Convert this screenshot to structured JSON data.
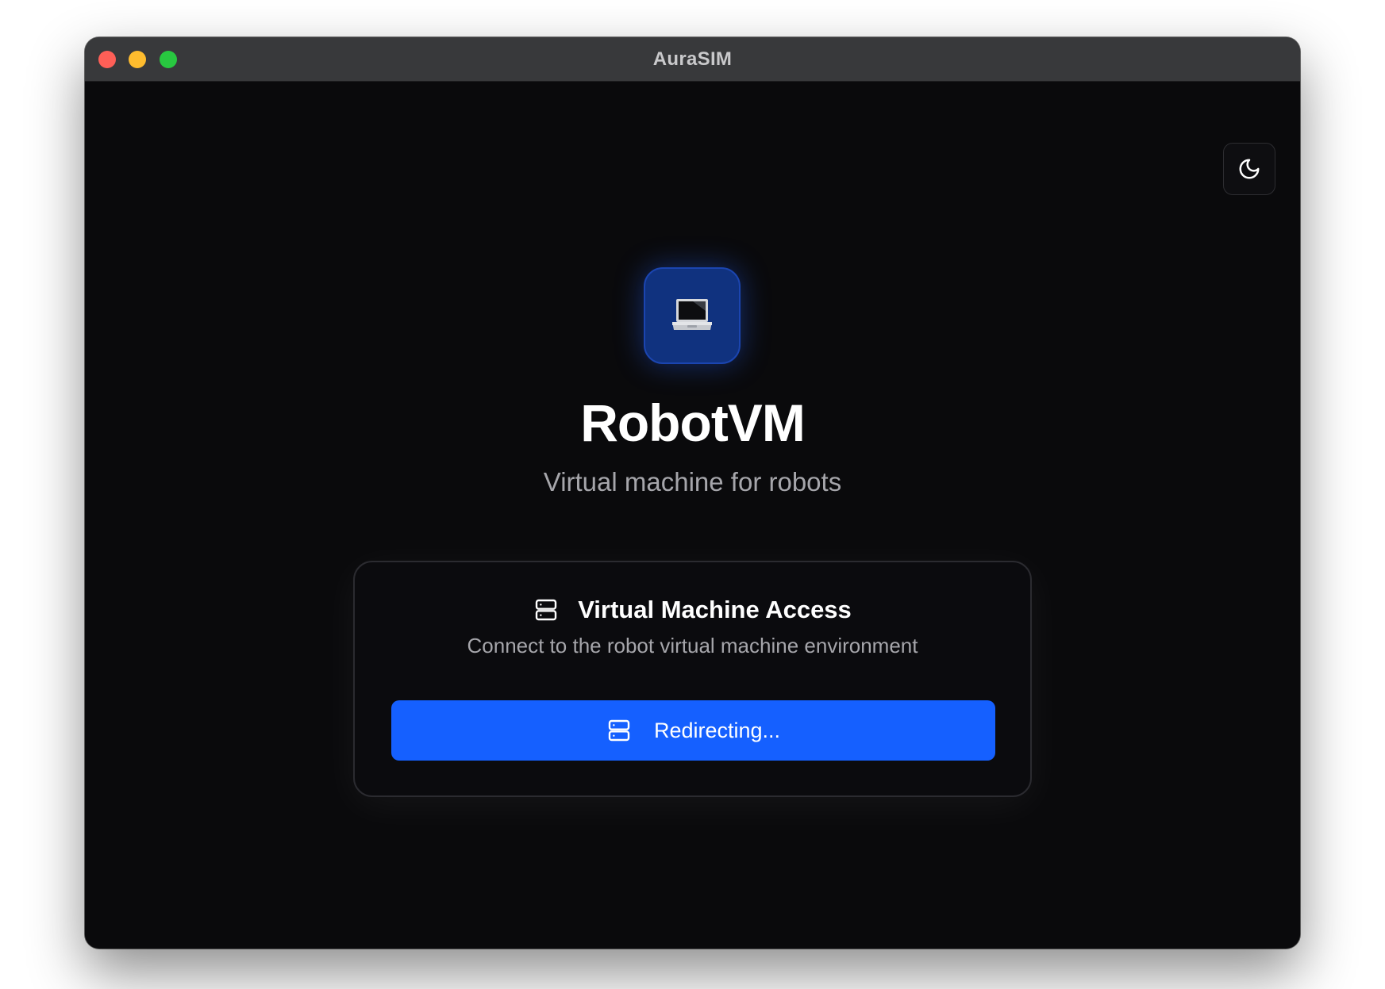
{
  "window": {
    "title": "AuraSIM",
    "controls": [
      "close",
      "minimize",
      "zoom"
    ]
  },
  "header": {
    "theme_toggle_icon": "moon-icon"
  },
  "hero": {
    "app_icon": "laptop-icon",
    "name": "RobotVM",
    "tagline": "Virtual machine for robots"
  },
  "card": {
    "icon": "server-icon",
    "title": "Virtual Machine Access",
    "description": "Connect to the robot virtual machine environment",
    "button": {
      "icon": "server-icon",
      "label": "Redirecting..."
    }
  },
  "colors": {
    "accent": "#1560ff",
    "background": "#0a0a0c",
    "titlebar": "#38393b",
    "app_icon_bg": "#10327f"
  }
}
